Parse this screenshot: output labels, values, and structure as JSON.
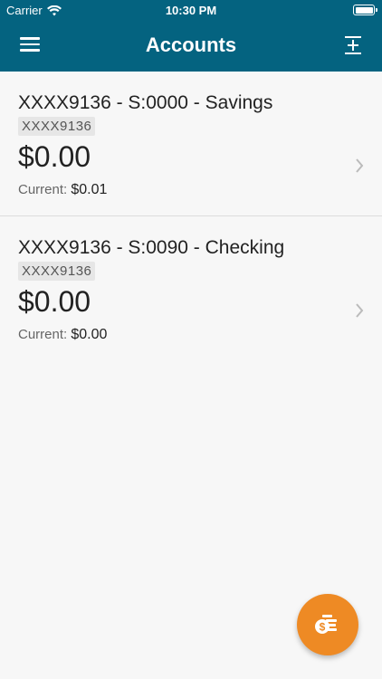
{
  "status_bar": {
    "carrier": "Carrier",
    "time": "10:30 PM"
  },
  "header": {
    "title": "Accounts"
  },
  "accounts": [
    {
      "name": "XXXX9136 - S:0000 - Savings",
      "tag": "XXXX9136",
      "balance": "$0.00",
      "current_label": "Current:",
      "current_value": "$0.01"
    },
    {
      "name": "XXXX9136 - S:0090 - Checking",
      "tag": "XXXX9136",
      "balance": "$0.00",
      "current_label": "Current:",
      "current_value": "$0.00"
    }
  ],
  "colors": {
    "header": "#046380",
    "fab": "#ee8a24",
    "background": "#f7f7f7"
  },
  "icons": {
    "menu": "hamburger-icon",
    "action": "add-subtract-icon",
    "fab": "money-transfer-icon",
    "row": "chevron-right-icon"
  }
}
